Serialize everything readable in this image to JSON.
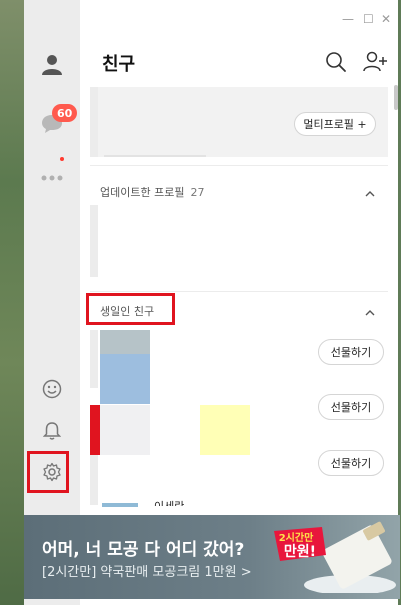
{
  "sidebar": {
    "items": [
      {
        "icon": "person-icon",
        "label": ""
      },
      {
        "icon": "chat-icon",
        "badge": "60"
      },
      {
        "icon": "more-icon"
      }
    ],
    "bottom": [
      {
        "icon": "emoji-icon"
      },
      {
        "icon": "bell-icon"
      },
      {
        "icon": "gear-icon"
      }
    ]
  },
  "window_controls": {
    "minimize": "—",
    "maximize": "☐",
    "close": "✕"
  },
  "header": {
    "title": "친구"
  },
  "profile": {
    "multi_profile_label": "멀티프로필 +"
  },
  "sections": {
    "updated": {
      "title": "업데이트한 프로필",
      "count": "27"
    },
    "birthday": {
      "title": "생일인 친구"
    }
  },
  "birthday_rows": [
    {
      "gift_label": "선물하기"
    },
    {
      "gift_label": "선물하기"
    },
    {
      "gift_label": "선물하기"
    }
  ],
  "partial_name": "이세란",
  "ad": {
    "title": "어머, 너 모공 다 어디 갔어?",
    "subtitle": "[2시간만] 약국판매 모공크림 1만원 >",
    "badge_top": "2시간만",
    "badge_bottom": "만원!"
  },
  "colors": {
    "highlight": "#e0141f",
    "badge": "#ff5a4e",
    "sidebar_bg": "#ececec"
  }
}
